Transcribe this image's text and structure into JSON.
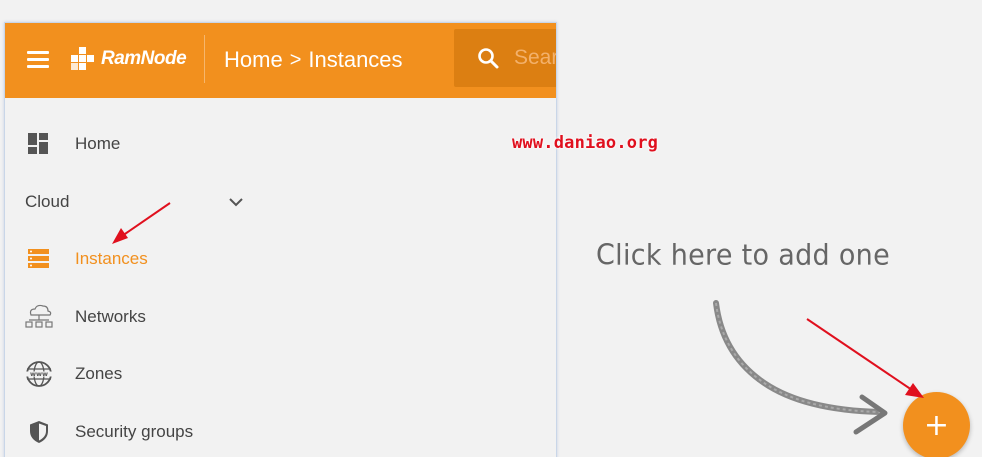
{
  "header": {
    "logo_text": "RamNode",
    "breadcrumb": {
      "home": "Home",
      "separator": ">",
      "current": "Instances"
    },
    "search": {
      "placeholder": "Search"
    }
  },
  "sidebar": {
    "items": [
      {
        "label": "Home",
        "icon": "dashboard-icon"
      },
      {
        "label": "Instances",
        "icon": "server-icon",
        "active": true
      },
      {
        "label": "Networks",
        "icon": "network-icon"
      },
      {
        "label": "Zones",
        "icon": "globe-www-icon"
      },
      {
        "label": "Security groups",
        "icon": "shield-icon"
      }
    ],
    "section": {
      "label": "Cloud",
      "expanded": true
    }
  },
  "main": {
    "hint": "Click here to add one",
    "fab_label": "+"
  },
  "watermark": "www.daniao.org",
  "colors": {
    "accent": "#f2901e",
    "search_bg": "#dc7f12",
    "annotation_red": "#e0101e",
    "text": "#444444"
  }
}
